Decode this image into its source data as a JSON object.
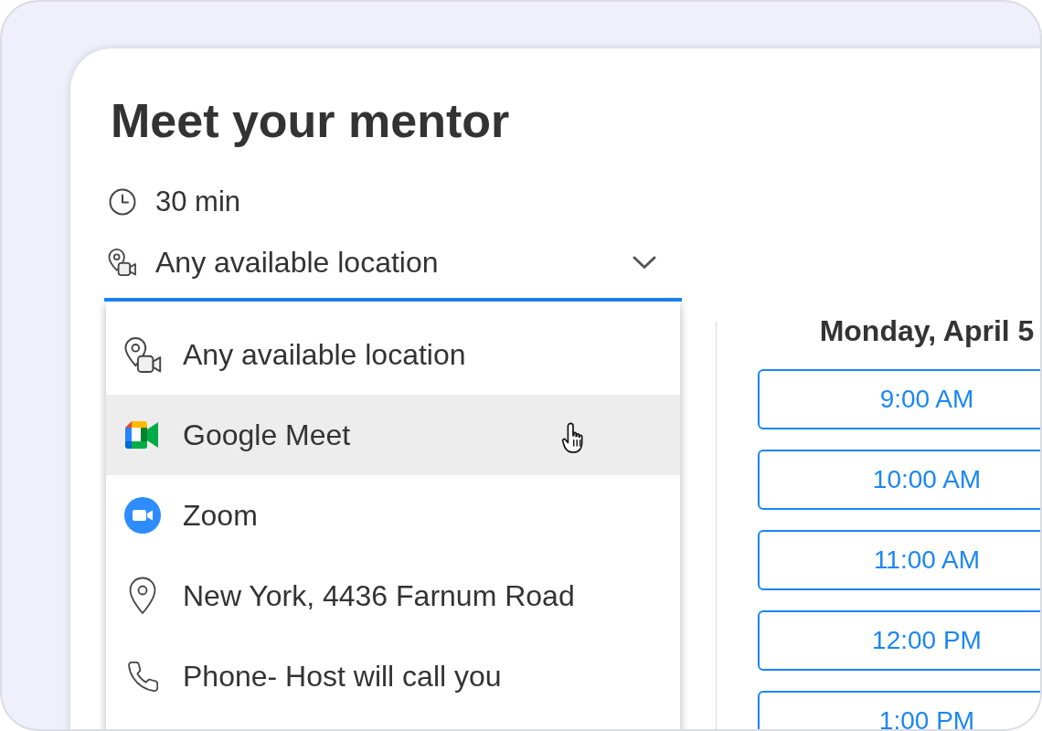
{
  "title": "Meet your mentor",
  "duration": "30 min",
  "location_select": {
    "value": "Any available location",
    "open": true
  },
  "location_menu": {
    "items": [
      {
        "kind": "any",
        "label": "Any available location",
        "highlighted": false
      },
      {
        "kind": "google_meet",
        "label": "Google Meet",
        "highlighted": true
      },
      {
        "kind": "zoom",
        "label": "Zoom",
        "highlighted": false
      },
      {
        "kind": "in_person",
        "label": "New York, 4436 Farnum Road",
        "highlighted": false
      },
      {
        "kind": "phone",
        "label": "Phone- Host will call you",
        "highlighted": false
      }
    ]
  },
  "schedule": {
    "date": "Monday, April 5",
    "time_slots": [
      "9:00 AM",
      "10:00 AM",
      "11:00 AM",
      "12:00 PM",
      "1:00 PM"
    ]
  }
}
